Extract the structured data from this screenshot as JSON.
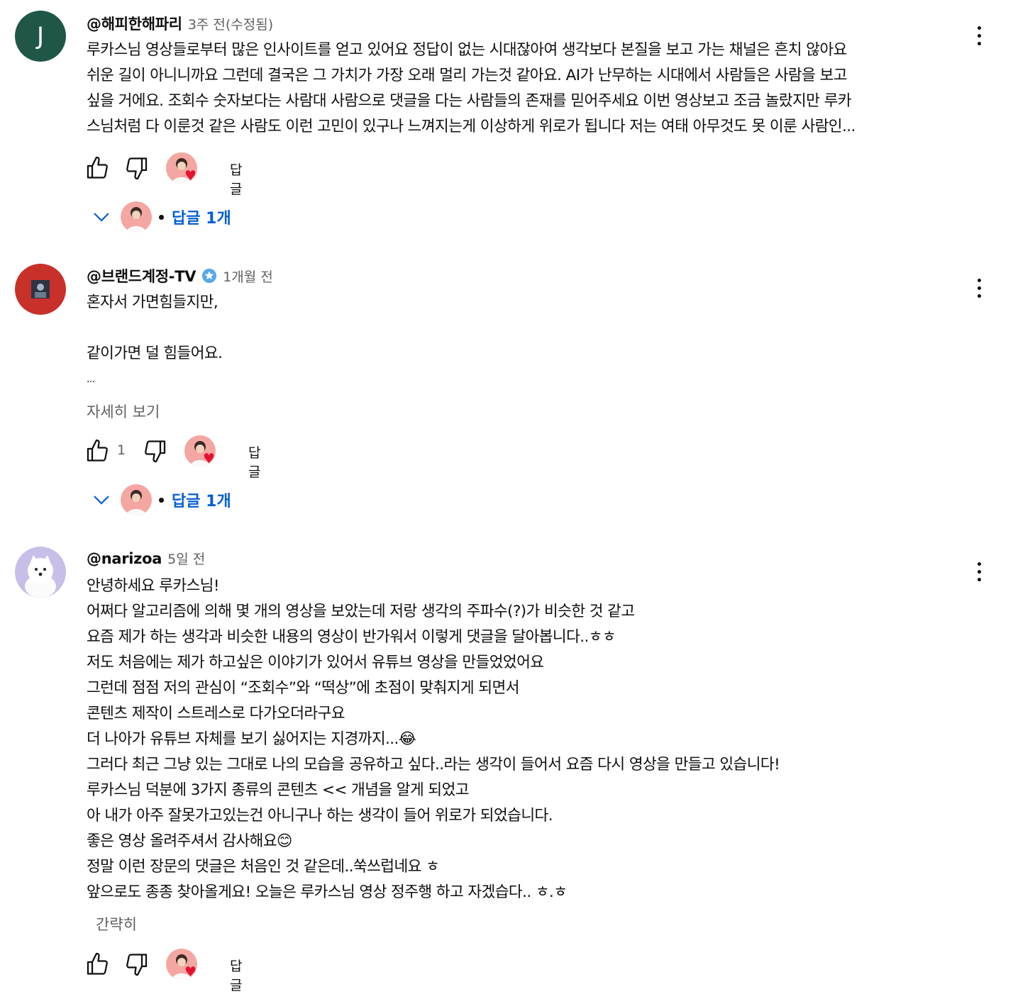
{
  "comments": [
    {
      "author": "@해피한해파리",
      "time": "3주 전(수정됨)",
      "avatar_letter": "J",
      "lines": [
        "루카스님 영상들로부터 많은 인사이트를 얻고 있어요 정답이 없는 시대잖아여 생각보다 본질을 보고 가는 채널은 흔치 않아요",
        "쉬운 길이 아니니까요 그런데 결국은 그 가치가 가장 오래 멀리 가는것 같아요. AI가 난무하는 시대에서 사람들은 사람을 보고",
        "싶을 거에요. 조회수 숫자보다는 사람대 사람으로 댓글을 다는 사람들의 존재를 믿어주세요 이번 영상보고 조금 놀랐지만 루카",
        "스님처럼 다 이룬것 같은 사람도 이런 고민이 있구나 느껴지는게 이상하게 위로가 됩니다 저는 여태 아무것도 못 이룬 사람인..."
      ],
      "reply_label": "답글",
      "replies_label": "답글 1개"
    },
    {
      "author": "@브랜드계정-TV",
      "time": "1개월 전",
      "lines": [
        "혼자서 가면힘들지만,",
        "",
        "같이가면 덜 힘들어요.",
        "..."
      ],
      "more_label": "자세히 보기",
      "like_count": "1",
      "reply_label": "답글",
      "replies_label": "답글 1개"
    },
    {
      "author": "@narizoa",
      "time": "5일 전",
      "lines": [
        "안녕하세요 루카스님!",
        "어쩌다 알고리즘에 의해 몇 개의 영상을 보았는데 저랑 생각의 주파수(?)가 비슷한 것 같고",
        "요즘 제가 하는 생각과 비슷한 내용의 영상이 반가워서 이렇게 댓글을 달아봅니다..ㅎㅎ",
        "저도 처음에는 제가 하고싶은 이야기가 있어서 유튜브 영상을 만들었었어요",
        "그런데 점점 저의 관심이 “조회수”와 “떡상”에 초점이 맞춰지게 되면서",
        "콘텐츠 제작이 스트레스로 다가오더라구요",
        "더 나아가 유튜브 자체를 보기 싫어지는 지경까지...😂",
        "그러다 최근 그냥 있는 그대로 나의 모습을 공유하고 싶다..라는 생각이 들어서 요즘 다시 영상을 만들고 있습니다!",
        "루카스님 덕분에 3가지 종류의 콘텐츠 << 개념을 알게 되었고",
        "아 내가 아주 잘못가고있는건 아니구나 하는 생각이 들어 위로가 되었습니다.",
        "좋은 영상 올려주셔서 감사해요😊",
        "정말 이런 장문의 댓글은 처음인 것 같은데..쑥쓰럽네요 ㅎ",
        "앞으로도 종종 찾아올게요! 오늘은 루카스님 영상 정주행 하고 자겠습다.. ㅎ.ㅎ"
      ],
      "less_label": "간략히",
      "reply_label": "답글"
    }
  ],
  "colors": {
    "link_blue": "#065fd4",
    "heart_red": "#e3132f",
    "meta_gray": "#606060"
  }
}
